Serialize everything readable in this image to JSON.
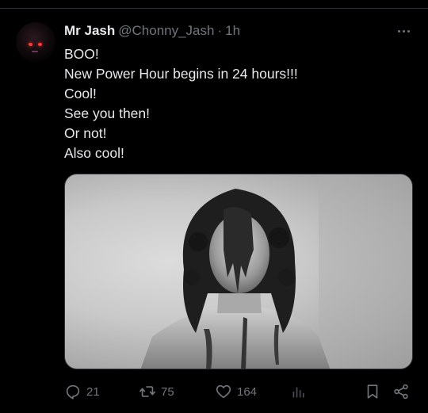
{
  "tweet": {
    "author_name": "Mr Jash",
    "author_handle": "@Chonny_Jash",
    "separator": "·",
    "time": "1h",
    "lines": [
      "BOO!",
      "New Power Hour begins in 24 hours!!!",
      "Cool!",
      "See you then!",
      "Or not!",
      "Also cool!"
    ]
  },
  "actions": {
    "replies": "21",
    "reposts": "75",
    "likes": "164",
    "views": ""
  },
  "icons": {
    "avatar": "avatar-dark-figure",
    "more": "more-horizontal-icon",
    "reply": "reply-icon",
    "repost": "repost-icon",
    "like": "heart-icon",
    "views": "analytics-icon",
    "bookmark": "bookmark-icon",
    "share": "share-icon"
  },
  "colors": {
    "background": "#000000",
    "text_primary": "#e7e9ea",
    "text_secondary": "#71767b",
    "divider": "#2f3336"
  }
}
